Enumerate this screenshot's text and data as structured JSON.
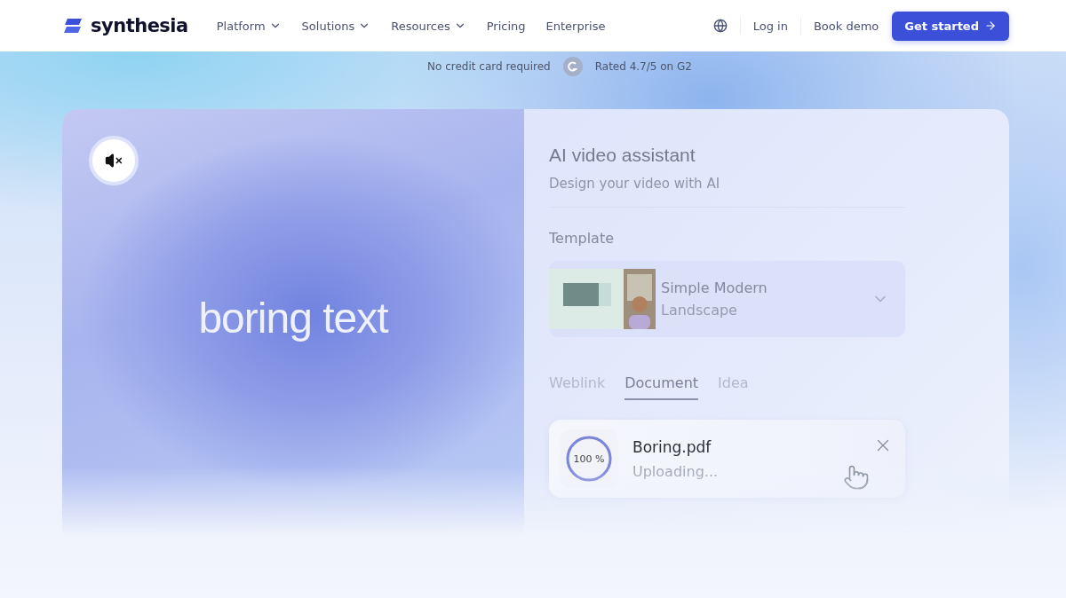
{
  "nav": {
    "brand": "synthesia",
    "items": [
      {
        "label": "Platform",
        "dropdown": true
      },
      {
        "label": "Solutions",
        "dropdown": true
      },
      {
        "label": "Resources",
        "dropdown": true
      },
      {
        "label": "Pricing",
        "dropdown": false
      },
      {
        "label": "Enterprise",
        "dropdown": false
      }
    ],
    "login": "Log in",
    "demo": "Book demo",
    "cta": "Get started"
  },
  "trust": {
    "note": "No credit card required",
    "rating": "Rated 4.7/5 on G2"
  },
  "video": {
    "muted": true,
    "caption": "boring text"
  },
  "assistant": {
    "title": "AI video assistant",
    "subtitle": "Design your video with AI",
    "template_label": "Template",
    "template": {
      "name": "Simple Modern",
      "format": "Landscape"
    },
    "tabs": [
      {
        "label": "Weblink",
        "selected": false
      },
      {
        "label": "Document",
        "selected": true
      },
      {
        "label": "Idea",
        "selected": false
      }
    ],
    "upload": {
      "file": "Boring.pdf",
      "status": "Uploading...",
      "progress_label": "100 %",
      "level": 1
    }
  }
}
